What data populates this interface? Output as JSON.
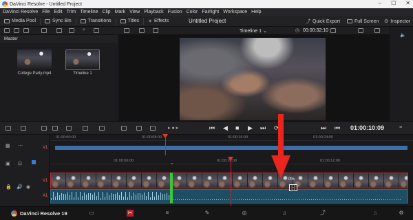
{
  "window": {
    "title": "DaVinci Resolve - Untitled Project",
    "controls": [
      "–",
      "☐",
      "✕"
    ]
  },
  "menu": [
    "DaVinci Resolve",
    "File",
    "Edit",
    "Trim",
    "Timeline",
    "Clip",
    "Mark",
    "View",
    "Playback",
    "Fusion",
    "Color",
    "Fairlight",
    "Workspace",
    "Help"
  ],
  "toolbar": {
    "media_pool": "Media Pool",
    "sync_bin": "Sync Bin",
    "transitions": "Transitions",
    "titles": "Titles",
    "effects": "Effects",
    "project_title": "Untitled Project",
    "quick_export": "Quick Export",
    "full_screen": "Full Screen",
    "inspector": "Inspector"
  },
  "subtool": {
    "timeline_name": "Timeline 1",
    "timecode": "00:00:32:10"
  },
  "media_pool": {
    "bin": "Master",
    "clips": [
      {
        "label": "College Party.mp4"
      },
      {
        "label": "Timeline 1"
      }
    ]
  },
  "transport": {
    "timecode": "01:00:10:09"
  },
  "timeline": {
    "upper_ruler": [
      "01:00:00:00",
      "01:00:08:00",
      "01:00:16:00",
      "01:00:24:00"
    ],
    "lower_ruler": [
      "01:00:06:00",
      "01:00:10:00",
      "01:00:12:00"
    ],
    "track_labels": {
      "v1_upper": "V1",
      "v1": "V1",
      "a1": "A1"
    },
    "speed_percent": "0%",
    "bracket": "[-]"
  },
  "pagebar": {
    "brand": "DaVinci Resolve 19"
  },
  "colors": {
    "accent_red": "#e8261e",
    "clip_blue": "#3e6ea8",
    "audio_teal": "#1d4e63",
    "marker_green": "#3ec43a"
  }
}
